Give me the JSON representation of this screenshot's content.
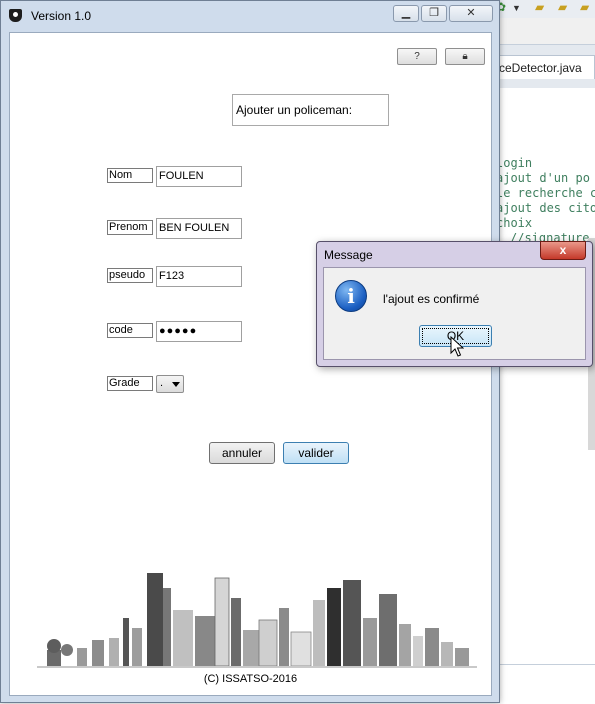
{
  "window": {
    "title": "Version 1.0",
    "minimize_icon": "minimize-icon",
    "maximize_icon": "maximize-icon",
    "close_icon": "close-icon"
  },
  "toolbar": {
    "left_icon": "help-icon",
    "right_icon": "lock-icon"
  },
  "form": {
    "heading": "Ajouter un policeman:",
    "fields": {
      "nom": {
        "label": "Nom",
        "value": "FOULEN"
      },
      "prenom": {
        "label": "Prenom",
        "value": "BEN FOULEN"
      },
      "pseudo": {
        "label": "pseudo",
        "value": "F123"
      },
      "code": {
        "label": "code",
        "value": "●●●●●"
      },
      "grade": {
        "label": "Grade",
        "value": "."
      }
    },
    "cancel_label": "annuler",
    "submit_label": "valider"
  },
  "footer": {
    "text": "(C) ISSATSO-2016"
  },
  "dialog": {
    "title": "Message",
    "close_label": "x",
    "icon": "info-icon",
    "message": "l'ajout es confirmé",
    "ok_label": "OK"
  },
  "ide": {
    "tab_label": "ceDetector.java",
    "code_lines": [
      "login",
      "ajout d'un po",
      "le recherche c",
      "ajout des cito",
      "choix",
      "//signature"
    ]
  },
  "colors": {
    "window_frame": "#cfdcec",
    "dialog_frame": "#d6cfe6",
    "close_button": "#c5392a",
    "accent_button": "#bfe0f5",
    "info_icon": "#1b5fc2",
    "code_comment": "#3f7f5f"
  }
}
